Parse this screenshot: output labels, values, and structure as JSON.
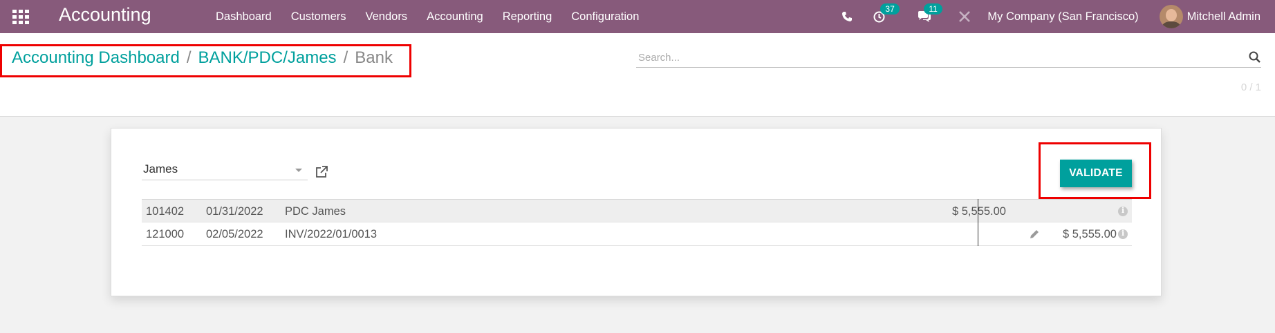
{
  "navbar": {
    "app_title": "Accounting",
    "menu": [
      "Dashboard",
      "Customers",
      "Vendors",
      "Accounting",
      "Reporting",
      "Configuration"
    ],
    "activity_count": "37",
    "messages_count": "11",
    "company": "My Company (San Francisco)",
    "user": "Mitchell Admin"
  },
  "breadcrumb": {
    "items": [
      "Accounting Dashboard",
      "BANK/PDC/James"
    ],
    "current": "Bank",
    "separator": "/"
  },
  "search": {
    "placeholder": "Search..."
  },
  "pager": {
    "text": "0 / 1"
  },
  "reconcile": {
    "partner": "James",
    "validate_label": "VALIDATE",
    "lines": [
      {
        "account": "101402",
        "date": "01/31/2022",
        "label": "PDC James",
        "debit": "$ 5,555.00",
        "credit": ""
      },
      {
        "account": "121000",
        "date": "02/05/2022",
        "label": "INV/2022/01/0013",
        "debit": "",
        "credit": "$ 5,555.00"
      }
    ]
  },
  "colors": {
    "navbar": "#875a7b",
    "accent": "#00a09d",
    "highlight": "#ee0000"
  }
}
